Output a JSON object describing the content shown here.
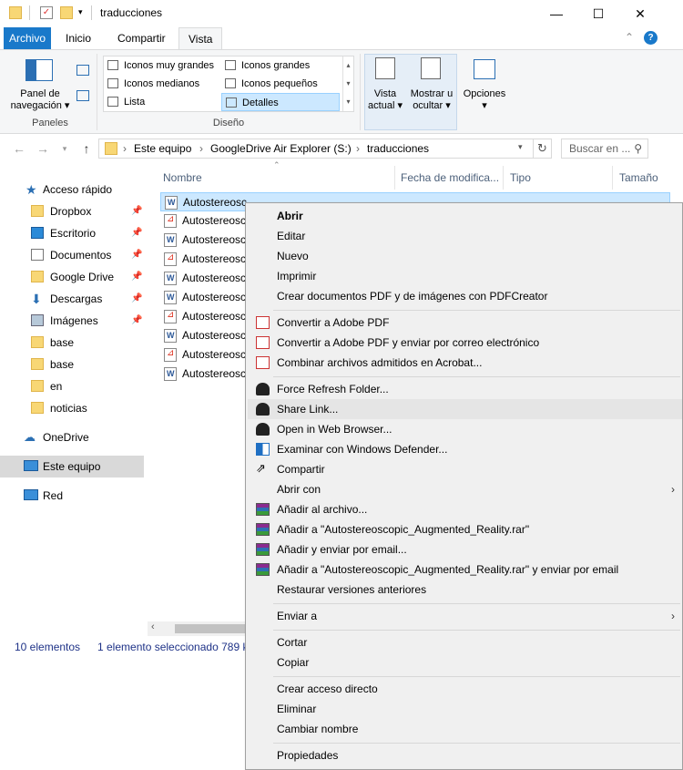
{
  "window": {
    "title": "traducciones",
    "controls": {
      "minimize": "—",
      "maximize": "☐",
      "close": "✕"
    }
  },
  "ribbon": {
    "tabs": [
      "Archivo",
      "Inicio",
      "Compartir",
      "Vista"
    ],
    "active_tab": "Vista",
    "panels_group": {
      "label": "Paneles",
      "nav_pane_label": "Panel de navegación"
    },
    "layout_group": {
      "label": "Diseño",
      "items": [
        "Iconos muy grandes",
        "Iconos grandes",
        "Iconos medianos",
        "Iconos pequeños",
        "Lista",
        "Detalles"
      ],
      "selected": "Detalles"
    },
    "current_view_label": "Vista actual",
    "show_hide_label": "Mostrar u ocultar",
    "options_label": "Opciones"
  },
  "address": {
    "crumbs": [
      "Este equipo",
      "GoogleDrive Air Explorer (S:)",
      "traducciones"
    ],
    "search_placeholder": "Buscar en ..."
  },
  "sidebar": {
    "quick_access": "Acceso rápido",
    "items": [
      {
        "label": "Dropbox",
        "pinned": true
      },
      {
        "label": "Escritorio",
        "pinned": true
      },
      {
        "label": "Documentos",
        "pinned": true
      },
      {
        "label": "Google Drive",
        "pinned": true
      },
      {
        "label": "Descargas",
        "pinned": true
      },
      {
        "label": "Imágenes",
        "pinned": true
      },
      {
        "label": "base",
        "pinned": false
      },
      {
        "label": "base",
        "pinned": false
      },
      {
        "label": "en",
        "pinned": false
      },
      {
        "label": "noticias",
        "pinned": false
      }
    ],
    "onedrive": "OneDrive",
    "this_pc": "Este equipo",
    "network": "Red"
  },
  "filelist": {
    "columns": [
      "Nombre",
      "Fecha de modifica...",
      "Tipo",
      "Tamaño"
    ],
    "files": [
      {
        "name": "Autostereosc",
        "type": "word"
      },
      {
        "name": "Autostereosc",
        "type": "pdf"
      },
      {
        "name": "Autostereosc",
        "type": "word"
      },
      {
        "name": "Autostereosc",
        "type": "pdf"
      },
      {
        "name": "Autostereosc",
        "type": "word"
      },
      {
        "name": "Autostereosc",
        "type": "word"
      },
      {
        "name": "Autostereosc",
        "type": "pdf"
      },
      {
        "name": "Autostereosc",
        "type": "word"
      },
      {
        "name": "Autostereosc",
        "type": "pdf"
      },
      {
        "name": "Autostereosc",
        "type": "word"
      }
    ]
  },
  "statusbar": {
    "count": "10 elementos",
    "selection": "1 elemento seleccionado  789 k"
  },
  "context_menu": {
    "hovered": "Share Link...",
    "groups": [
      [
        "Abrir",
        "Editar",
        "Nuevo",
        "Imprimir",
        "Crear documentos PDF y de imágenes con PDFCreator"
      ],
      [
        "Convertir a Adobe PDF",
        "Convertir a Adobe PDF y enviar por correo electrónico",
        "Combinar archivos admitidos en Acrobat..."
      ],
      [
        "Force Refresh Folder...",
        "Share Link...",
        "Open in Web Browser...",
        "Examinar con Windows Defender...",
        "Compartir",
        "Abrir con",
        "Añadir al archivo...",
        "Añadir a \"Autostereoscopic_Augmented_Reality.rar\"",
        "Añadir y enviar por email...",
        "Añadir a \"Autostereoscopic_Augmented_Reality.rar\" y enviar por email",
        "Restaurar versiones anteriores"
      ],
      [
        "Enviar a"
      ],
      [
        "Cortar",
        "Copiar"
      ],
      [
        "Crear acceso directo",
        "Eliminar",
        "Cambiar nombre"
      ],
      [
        "Propiedades"
      ]
    ]
  },
  "colors": {
    "accent": "#1979ca",
    "selection": "#cce8ff",
    "menu_bg": "#f0f0f0"
  }
}
